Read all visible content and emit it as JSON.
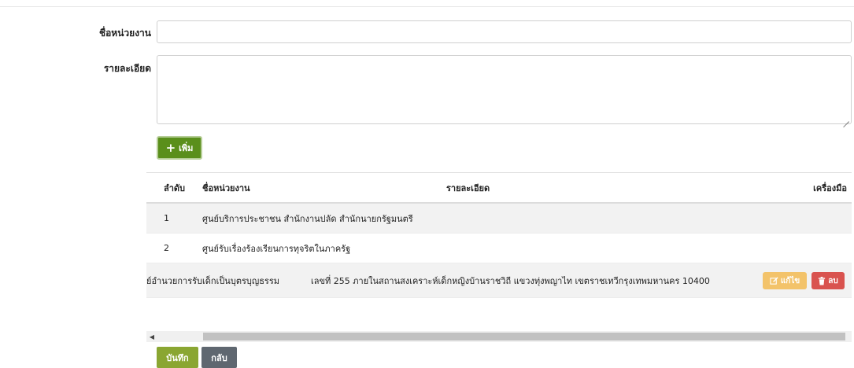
{
  "form": {
    "name_label": "ชื่อหน่วยงาน",
    "name_value": "",
    "detail_label": "รายละเอียด",
    "detail_value": ""
  },
  "add_button": {
    "icon": "plus-icon",
    "label": "เพิ่ม"
  },
  "table": {
    "headers": {
      "order": "ลำดับ",
      "name": "ชื่อหน่วยงาน",
      "detail": "รายละเอียด",
      "tools": "เครื่องมือ"
    },
    "rows": [
      {
        "order": "1",
        "name": "ศูนย์บริการประชาชน สำนักงานปลัด สำนักนายกรัฐมนตรี",
        "detail": ""
      },
      {
        "order": "2",
        "name": "ศูนย์รับเรื่องร้องเรียนการทุจริตในภาครัฐ",
        "detail": ""
      },
      {
        "order": "",
        "name": "ย์อำนวยการรับเด็กเป็นบุตรบุญธรรม",
        "detail": "เลขที่ 255 ภายในสถานสงเคราะห์เด็กหญิงบ้านราชวิถี แขวงทุ่งพญาไท เขตราชเทวีกรุงเทพมหานคร 10400"
      }
    ],
    "edit_label": "แก้ไข",
    "delete_label": "ลบ"
  },
  "footer": {
    "save_label": "บันทึก",
    "back_label": "กลับ"
  },
  "colors": {
    "add": "#5a8f1b",
    "save": "#8aa632",
    "back": "#5f6770",
    "edit": "#f3c36a",
    "delete": "#d9534f"
  }
}
